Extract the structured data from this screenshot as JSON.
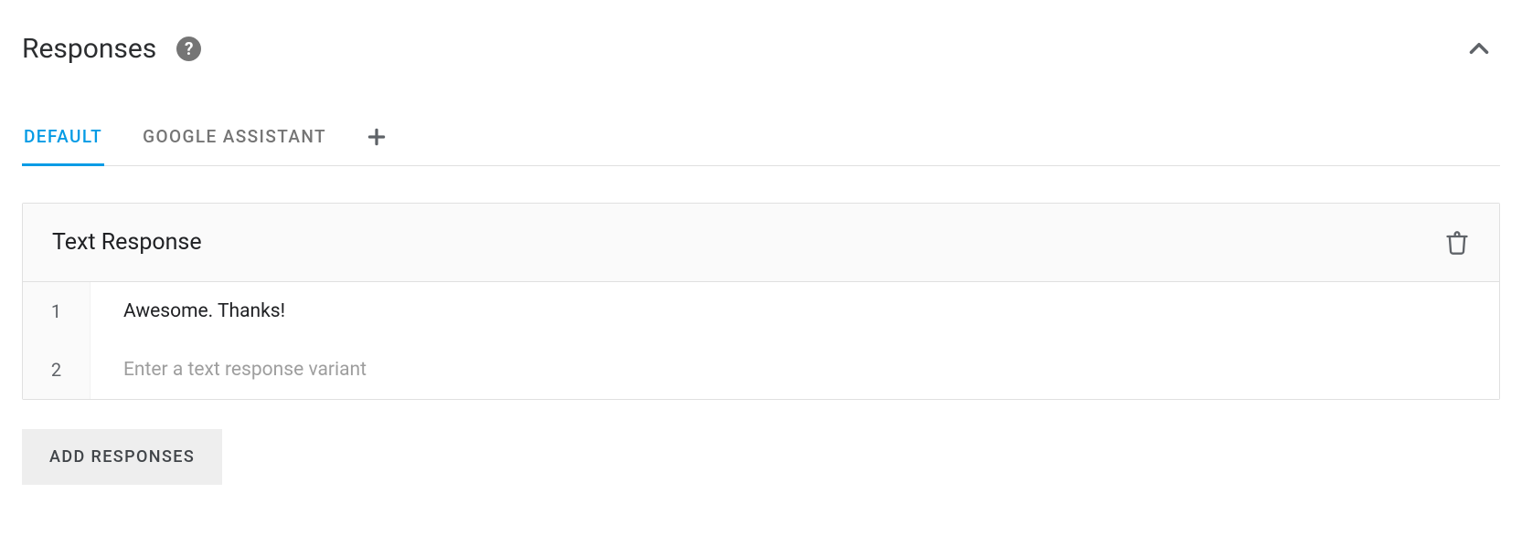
{
  "section": {
    "title": "Responses"
  },
  "tabs": [
    {
      "label": "DEFAULT",
      "active": true
    },
    {
      "label": "GOOGLE ASSISTANT",
      "active": false
    }
  ],
  "card": {
    "title": "Text Response",
    "rows": [
      {
        "num": "1",
        "value": "Awesome. Thanks!",
        "placeholder": ""
      },
      {
        "num": "2",
        "value": "",
        "placeholder": "Enter a text response variant"
      }
    ]
  },
  "buttons": {
    "add_responses": "ADD RESPONSES"
  },
  "colors": {
    "accent": "#039be5",
    "muted": "#757575",
    "border": "#e0e0e0"
  }
}
